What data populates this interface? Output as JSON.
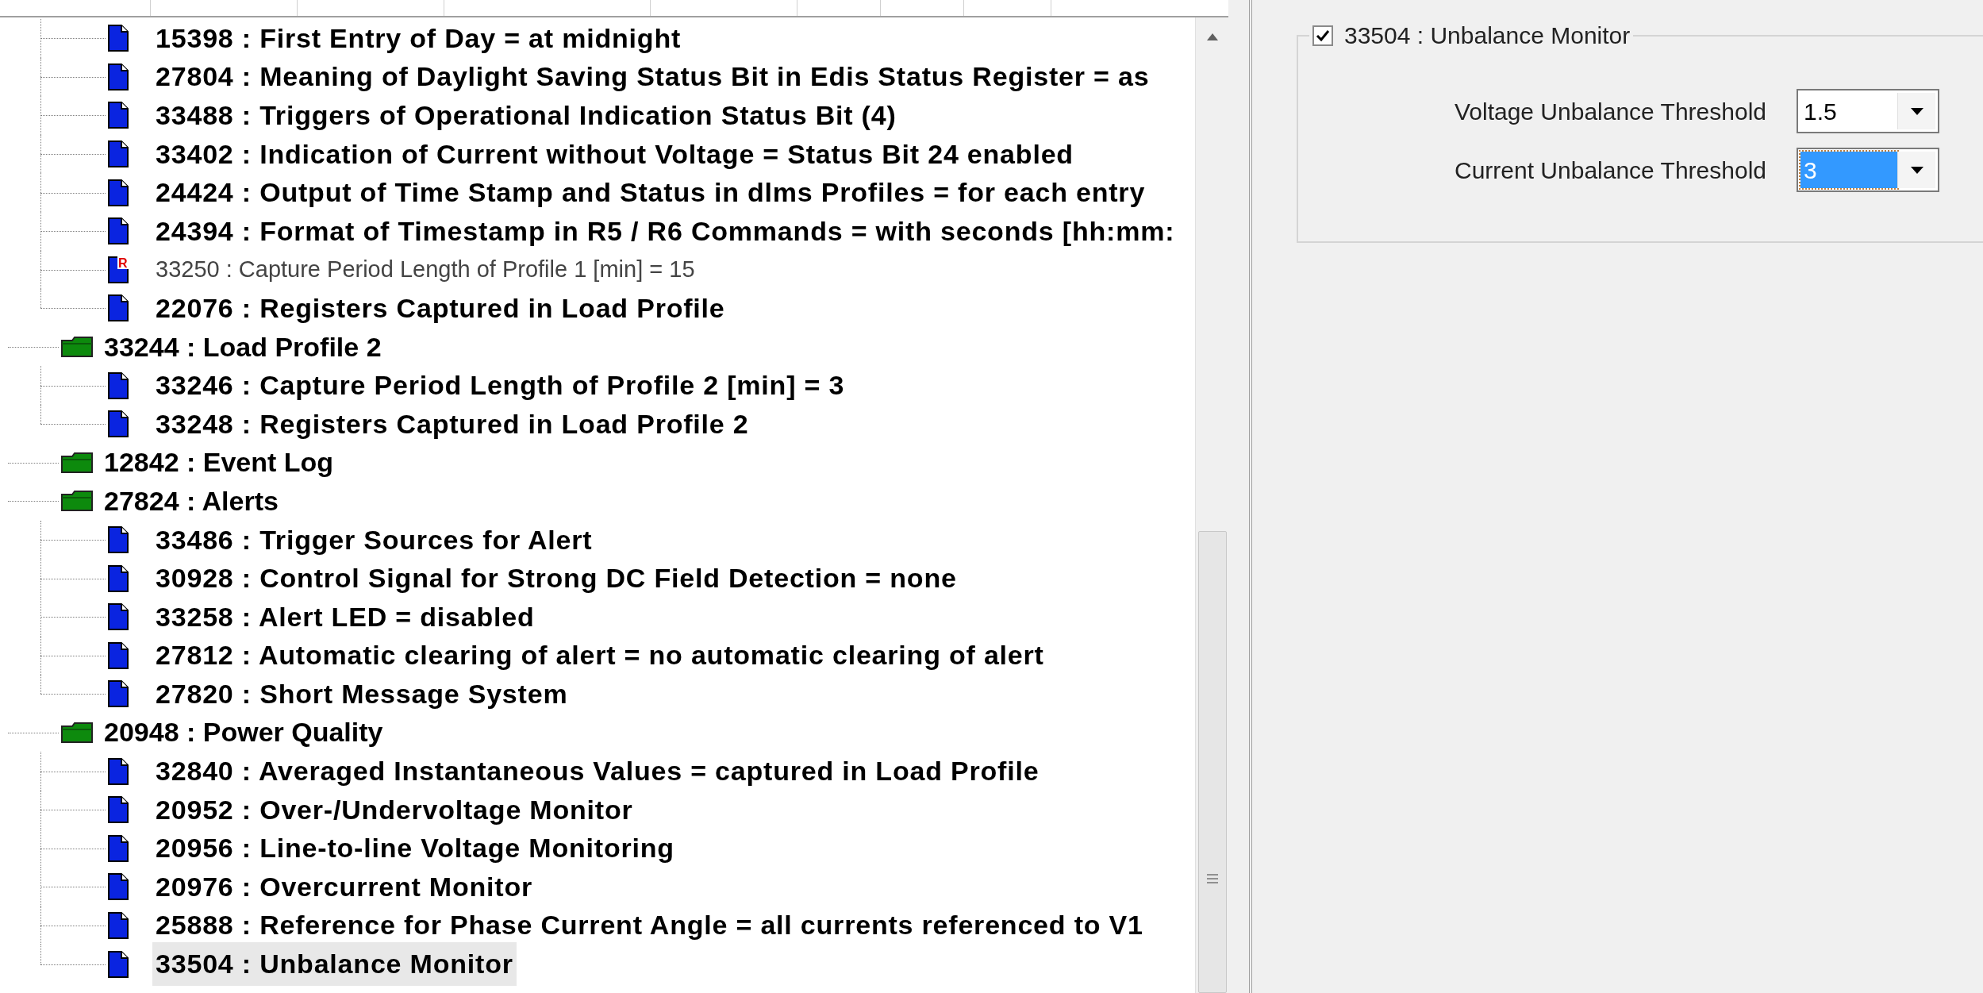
{
  "tree": {
    "partial_group": {
      "children": [
        {
          "label": "15398 : First Entry of Day = at midnight",
          "kind": "leaf",
          "bold": true,
          "selected": false
        },
        {
          "label": "27804 : Meaning of Daylight Saving Status Bit in Edis Status Register = as",
          "kind": "leaf",
          "bold": true,
          "selected": false
        },
        {
          "label": "33488 : Triggers of Operational Indication Status Bit (4)",
          "kind": "leaf",
          "bold": true,
          "selected": false
        },
        {
          "label": "33402 : Indication of Current without Voltage = Status Bit 24 enabled",
          "kind": "leaf",
          "bold": true,
          "selected": false
        },
        {
          "label": "24424 : Output of Time Stamp and Status in dlms Profiles = for each entry",
          "kind": "leaf",
          "bold": true,
          "selected": false
        },
        {
          "label": "24394 : Format of Timestamp in R5 / R6 Commands = with seconds [hh:mm:",
          "kind": "leaf",
          "bold": true,
          "selected": false
        },
        {
          "label": "33250 : Capture Period Length of Profile 1 [min] = 15",
          "kind": "leaf",
          "bold": false,
          "badge": "R",
          "selected": false
        },
        {
          "label": "22076 : Registers Captured in Load Profile",
          "kind": "leaf",
          "bold": true,
          "selected": false
        }
      ]
    },
    "folders": [
      {
        "label": "33244 : Load Profile 2",
        "kind": "folder",
        "children": [
          {
            "label": "33246 : Capture Period Length of Profile 2 [min] = 3",
            "kind": "leaf",
            "bold": true,
            "selected": false
          },
          {
            "label": "33248 : Registers Captured in Load Profile 2",
            "kind": "leaf",
            "bold": true,
            "selected": false
          }
        ]
      },
      {
        "label": "12842 : Event Log",
        "kind": "folder"
      },
      {
        "label": "27824 : Alerts",
        "kind": "folder",
        "children": [
          {
            "label": "33486 : Trigger Sources for Alert",
            "kind": "leaf",
            "bold": true,
            "selected": false
          },
          {
            "label": "30928 : Control Signal for Strong DC Field Detection = none",
            "kind": "leaf",
            "bold": true,
            "selected": false
          },
          {
            "label": "33258 : Alert LED = disabled",
            "kind": "leaf",
            "bold": true,
            "selected": false
          },
          {
            "label": "27812 : Automatic clearing of alert = no automatic clearing of alert",
            "kind": "leaf",
            "bold": true,
            "selected": false
          },
          {
            "label": "27820 : Short Message System",
            "kind": "leaf",
            "bold": true,
            "selected": false
          }
        ]
      },
      {
        "label": "20948 : Power Quality",
        "kind": "folder",
        "children": [
          {
            "label": "32840 : Averaged Instantaneous Values = captured in Load Profile",
            "kind": "leaf",
            "bold": true,
            "selected": false
          },
          {
            "label": "20952 : Over-/Undervoltage Monitor",
            "kind": "leaf",
            "bold": true,
            "selected": false
          },
          {
            "label": "20956 : Line-to-line Voltage Monitoring",
            "kind": "leaf",
            "bold": true,
            "selected": false
          },
          {
            "label": "20976 : Overcurrent Monitor",
            "kind": "leaf",
            "bold": true,
            "selected": false
          },
          {
            "label": "25888 : Reference for Phase Current Angle = all currents referenced to V1",
            "kind": "leaf",
            "bold": true,
            "selected": false
          },
          {
            "label": "33504 : Unbalance Monitor",
            "kind": "leaf",
            "bold": true,
            "selected": true
          }
        ]
      }
    ]
  },
  "group": {
    "title": "33504 : Unbalance Monitor",
    "checked": true,
    "fields": [
      {
        "label": "Voltage Unbalance Threshold",
        "value": "1.5",
        "focused": false
      },
      {
        "label": "Current Unbalance Threshold",
        "value": "3",
        "focused": true
      }
    ]
  }
}
